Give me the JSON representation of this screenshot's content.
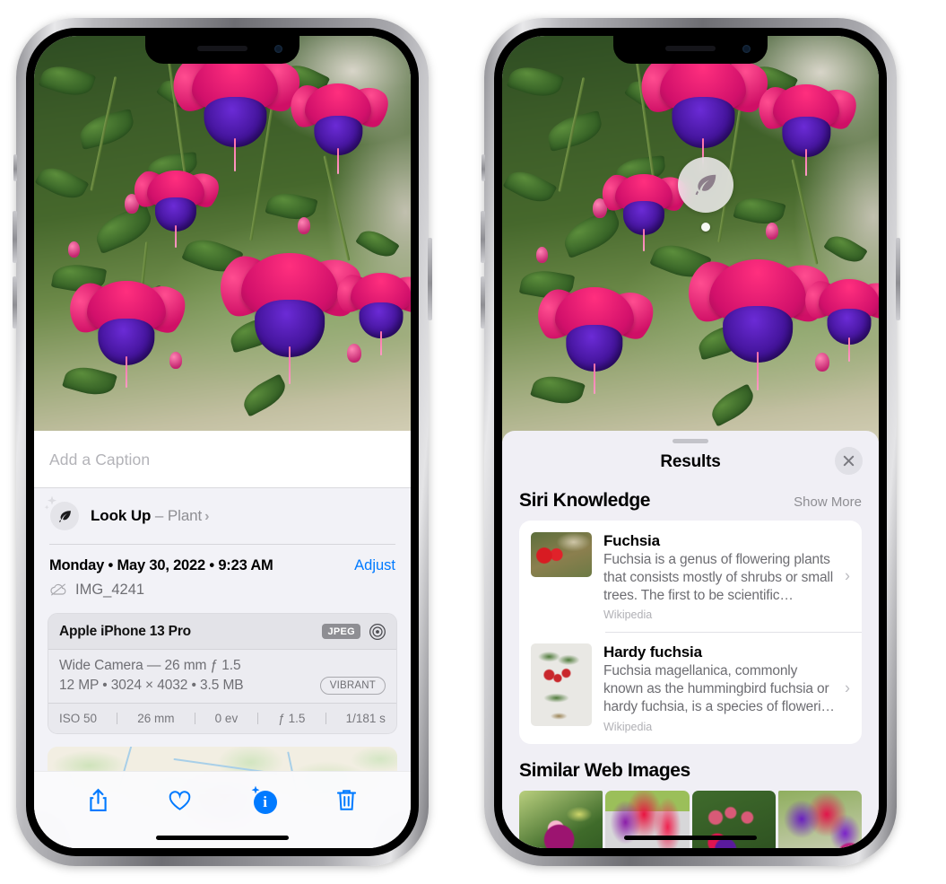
{
  "left_phone": {
    "name": "photo-detail-screen",
    "photo": {
      "alt": "fuchsia-flowers-photo"
    },
    "caption": {
      "placeholder": "Add a Caption",
      "value": ""
    },
    "lookup": {
      "icon": "leaf-icon",
      "sparkle_icon": "sparkles-icon",
      "label": "Look Up",
      "separator": " – ",
      "subject": "Plant",
      "chevron": "›"
    },
    "date_row": {
      "date": "Monday • May 30, 2022 • 9:23 AM",
      "adjust_label": "Adjust"
    },
    "file_row": {
      "cloud_icon": "icloud-slash-icon",
      "filename": "IMG_4241"
    },
    "metadata": {
      "device": "Apple iPhone 13 Pro",
      "format_badge": "JPEG",
      "aperture_icon": "aperture-icon",
      "lens_line": "Wide Camera — 26 mm ƒ 1.5",
      "specs_line": "12 MP • 3024 × 4032 • 3.5 MB",
      "style_badge": "VIBRANT",
      "exif": [
        "ISO 50",
        "26 mm",
        "0 ev",
        "ƒ 1.5",
        "1/181 s"
      ]
    },
    "map": {
      "label": "photo-location-map",
      "pin": "photo-pin"
    },
    "toolbar": [
      {
        "name": "share-button",
        "icon": "share-icon"
      },
      {
        "name": "favorite-button",
        "icon": "heart-icon"
      },
      {
        "name": "info-button",
        "icon": "info-sparkle-icon",
        "active": true
      },
      {
        "name": "delete-button",
        "icon": "trash-icon"
      }
    ]
  },
  "right_phone": {
    "name": "visual-look-up-results-screen",
    "photo": {
      "alt": "fuchsia-flowers-photo"
    },
    "badge": {
      "icon": "leaf-icon",
      "name": "visual-look-up-badge"
    },
    "sheet": {
      "grabber": "sheet-grabber",
      "title": "Results",
      "close_icon": "close-icon",
      "siri_knowledge": {
        "title": "Siri Knowledge",
        "action": "Show More",
        "items": [
          {
            "name": "Fuchsia",
            "description": "Fuchsia is a genus of flowering plants that consists mostly of shrubs or small trees. The first to be scientific…",
            "source": "Wikipedia",
            "thumb": "fuchsia-red-flowers-thumb",
            "chevron": "›"
          },
          {
            "name": "Hardy fuchsia",
            "description": "Fuchsia magellanica, commonly known as the hummingbird fuchsia or hardy fuchsia, is a species of floweri…",
            "source": "Wikipedia",
            "thumb": "hardy-fuchsia-specimen-thumb",
            "chevron": "›"
          }
        ]
      },
      "similar_web_images": {
        "title": "Similar Web Images",
        "items": [
          {
            "name": "web-image-1"
          },
          {
            "name": "web-image-2"
          },
          {
            "name": "web-image-3"
          },
          {
            "name": "web-image-4"
          }
        ]
      }
    }
  },
  "colors": {
    "accent_blue": "#007aff",
    "sheet_bg": "#f0eff5",
    "detail_bg": "#f2f2f7",
    "card_bg": "#ffffff",
    "meta_card_bg": "#e8e8ed",
    "secondary_text": "#6d6d72",
    "tertiary_text": "#b0b0b5"
  }
}
